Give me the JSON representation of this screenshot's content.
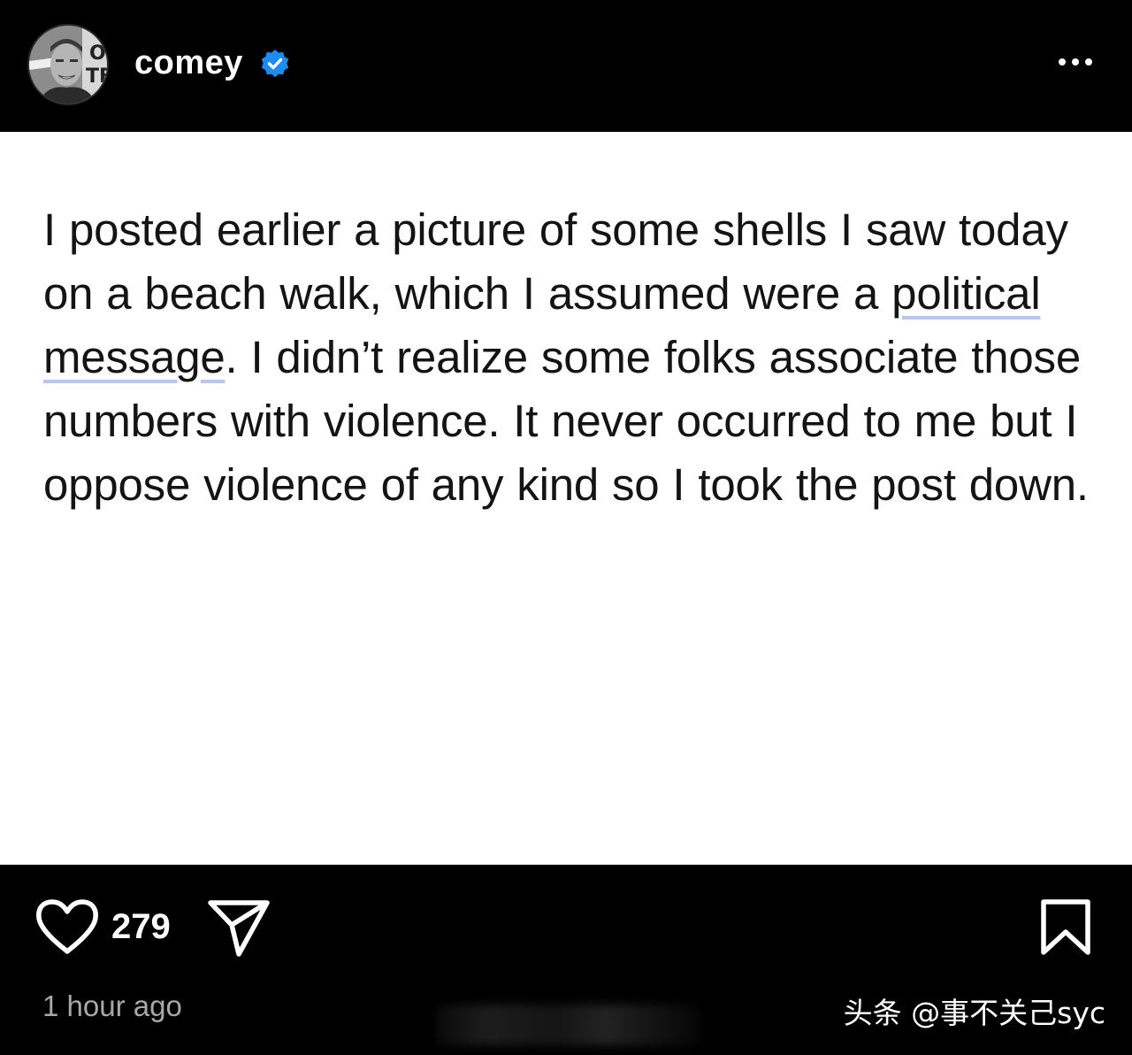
{
  "header": {
    "username": "comey",
    "verified": true,
    "avatar_icon": "profile-photo-avatar",
    "more_icon": "more-options-icon"
  },
  "post": {
    "text_before": "I posted earlier a picture of some shells I saw today on a beach walk, which I assumed were a ",
    "highlight_1": "political",
    "text_between": " ",
    "highlight_2": "message",
    "text_after": ". I didn’t realize some folks associate those numbers with violence. It never occurred to me but I oppose violence of any kind so I took the post down."
  },
  "footer": {
    "like_count": "279",
    "timestamp": "1 hour ago",
    "watermark": "头条 @事不关己syc",
    "like_icon": "heart-icon",
    "share_icon": "send-icon",
    "save_icon": "bookmark-icon"
  },
  "colors": {
    "background": "#000000",
    "card": "#ffffff",
    "text": "#141414",
    "verified_badge": "#1d8cf0",
    "timestamp": "#a8a8a8",
    "underline": "#b7c6ee"
  }
}
